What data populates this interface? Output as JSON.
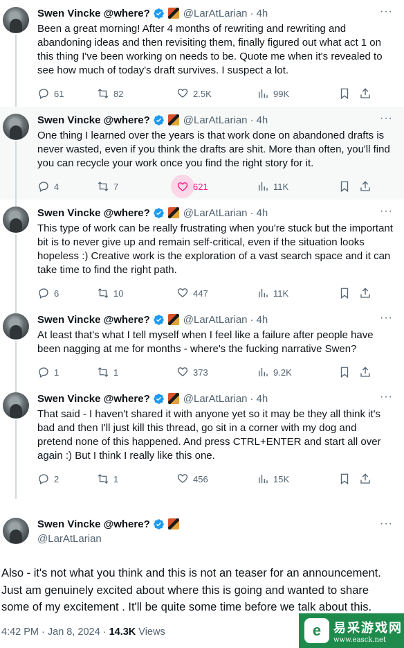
{
  "author": {
    "name": "Swen Vincke @where?",
    "handle": "@LarAtLarian"
  },
  "tweets": [
    {
      "time": "4h",
      "text": "Been a great morning! After 4 months of rewriting and rewriting and abandoning ideas and then revisiting them, finally figured out what act 1 on this thing I've been working on needs to be. Quote me when it's revealed to see how much of today's draft survives. I suspect a lot.",
      "replies": "61",
      "reposts": "82",
      "likes": "2.5K",
      "views": "99K",
      "liked": false
    },
    {
      "time": "4h",
      "text": "One thing I learned over the years is that work done on abandoned drafts is never wasted, even if you think the drafts are shit. More than often, you'll find you can recycle your work once you find the right story for it.",
      "replies": "4",
      "reposts": "7",
      "likes": "621",
      "views": "11K",
      "liked": true
    },
    {
      "time": "4h",
      "text": "This type of work can be really frustrating when you're stuck but the important bit is to never give up and remain self-critical, even if the situation looks hopeless :) Creative work is the exploration of a vast search space and it can take time to find the right path.",
      "replies": "6",
      "reposts": "10",
      "likes": "447",
      "views": "11K",
      "liked": false
    },
    {
      "time": "4h",
      "text": "At least that's what I tell myself when I feel like a failure after people have been nagging at me for months - where's the fucking narrative Swen?",
      "replies": "1",
      "reposts": "1",
      "likes": "373",
      "views": "9.2K",
      "liked": false
    },
    {
      "time": "4h",
      "text": "That said - I haven't shared it with anyone yet so it may be they all think it's bad and then I'll just kill this thread, go sit in a corner with my dog and pretend none of this happened. And press CTRL+ENTER and start all over again :) But I think I really like this one.",
      "replies": "2",
      "reposts": "1",
      "likes": "456",
      "views": "15K",
      "liked": false
    }
  ],
  "main_tweet": {
    "text": "Also - it's not what you think and this is not an teaser for an announcement. Just am genuinely excited about where this is going and wanted to share some of my excitement . It'll be quite some time before we talk about this.",
    "timestamp": "4:42 PM · Jan 8, 2024 · ",
    "views_count": "14.3K",
    "views_label": " Views"
  },
  "watermark": {
    "chinese": "易采游戏网",
    "url": "www.easck.net"
  },
  "colors": {
    "accent": "#1d9bf0",
    "like": "#f91880",
    "secondary_text": "#536471",
    "watermark_green": "#1e8b4c"
  },
  "icons": [
    "reply-icon",
    "repost-icon",
    "like-icon",
    "views-icon",
    "bookmark-icon",
    "share-icon",
    "more-icon",
    "verified-badge-icon"
  ]
}
